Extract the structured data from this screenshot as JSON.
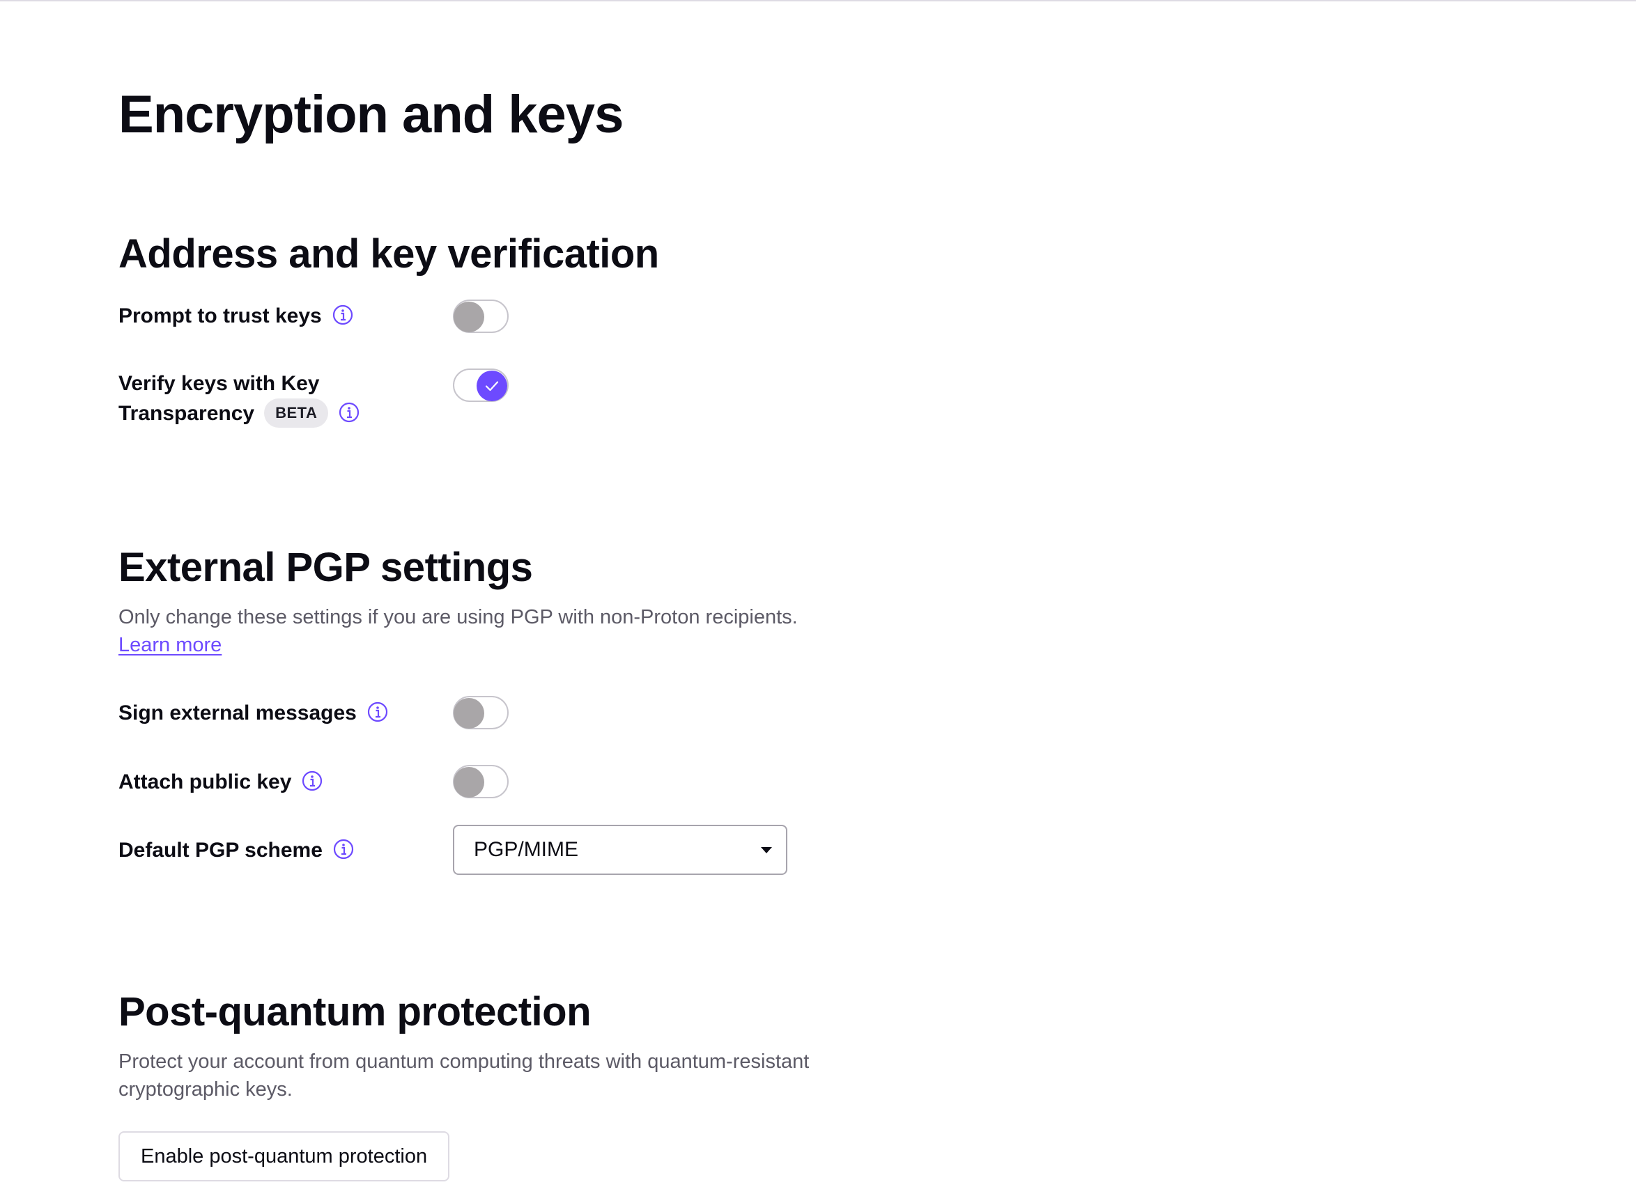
{
  "page": {
    "title": "Encryption and keys"
  },
  "address_verification": {
    "title": "Address and key verification",
    "settings": [
      {
        "label": "Prompt to trust keys",
        "enabled": false
      },
      {
        "label_line1": "Verify keys with Key",
        "label_line2": "Transparency",
        "badge": "BETA",
        "enabled": true
      }
    ]
  },
  "external_pgp": {
    "title": "External PGP settings",
    "description": "Only change these settings if you are using PGP with non-Proton recipients.",
    "learn_more": "Learn more",
    "sign_external": {
      "label": "Sign external messages",
      "enabled": false
    },
    "attach_public_key": {
      "label": "Attach public key",
      "enabled": false
    },
    "default_scheme": {
      "label": "Default PGP scheme",
      "value": "PGP/MIME"
    }
  },
  "post_quantum": {
    "title": "Post-quantum protection",
    "description_line1": "Protect your account from quantum computing threats with quantum-resistant",
    "description_line2": "cryptographic keys.",
    "button": "Enable post-quantum protection"
  },
  "icons": {
    "info": "info-icon",
    "check": "check-icon",
    "caret": "chevron-down-icon"
  },
  "colors": {
    "accent": "#6d4aff",
    "toggle_off": "#a9a6a8",
    "text_muted": "#5c5a66"
  }
}
